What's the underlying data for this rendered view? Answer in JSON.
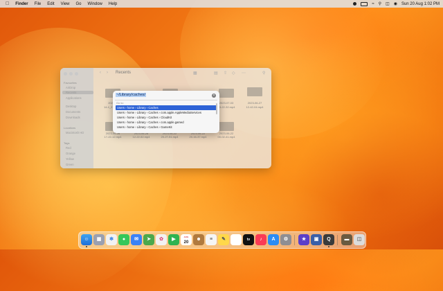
{
  "menubar": {
    "apple": "",
    "items": [
      "Finder",
      "File",
      "Edit",
      "View",
      "Go",
      "Window",
      "Help"
    ],
    "clock": "Sun 20 Aug  1:02 PM"
  },
  "finder": {
    "title": "Recents",
    "sidebar": {
      "fav_header": "Favourites",
      "favourites": [
        "AirDrop",
        "Recents",
        "Applications",
        "Desktop",
        "Documents",
        "Downloads"
      ],
      "loc_header": "Locations",
      "locations": [
        "Macintosh HD"
      ],
      "tags_header": "Tags",
      "tags": [
        "Red",
        "Orange",
        "Yellow",
        "Green"
      ]
    },
    "files_row1": [
      {
        "name": "2023-...",
        "sub": "14.4_21_..."
      },
      {
        "name": "",
        "sub": ""
      },
      {
        "name": "",
        "sub": ""
      },
      {
        "name": "",
        "sub": ""
      },
      {
        "name": "2023-07-03",
        "sub": "13-22-32.mp4"
      },
      {
        "name": "2023-06-27",
        "sub": "12-42-04.mp4"
      }
    ],
    "files_row2": [
      {
        "name": "2023-06-26",
        "sub": "17-22-12.mp4"
      },
      {
        "name": "2023-06-26",
        "sub": "12-22-52.mp4"
      },
      {
        "name": "2023-06-22",
        "sub": "20-27-51.mp4"
      },
      {
        "name": "2023-06-22",
        "sub": "20-16-37.mp4"
      },
      {
        "name": "2023-06-22",
        "sub": "00-02-41.mp4"
      }
    ]
  },
  "goto": {
    "path": "~/Library/caches/",
    "header": "Go to:",
    "results": [
      "Users  ›  home  ›  Library  ›  Caches",
      "Users  ›  home  ›  Library  ›  Caches  ›  com.apple.AppleMediaServices",
      "Users  ›  home  ›  Library  ›  Caches  ›  CloudKit",
      "Users  ›  home  ›  Library  ›  Caches  ›  com.apple.gamed",
      "Users  ›  home  ›  Library  ›  Caches  ›  GameKit"
    ],
    "clear_icon": "×"
  },
  "dock": {
    "calendar_day": "20",
    "calendar_month": "AUG",
    "tv_label": "tv"
  }
}
